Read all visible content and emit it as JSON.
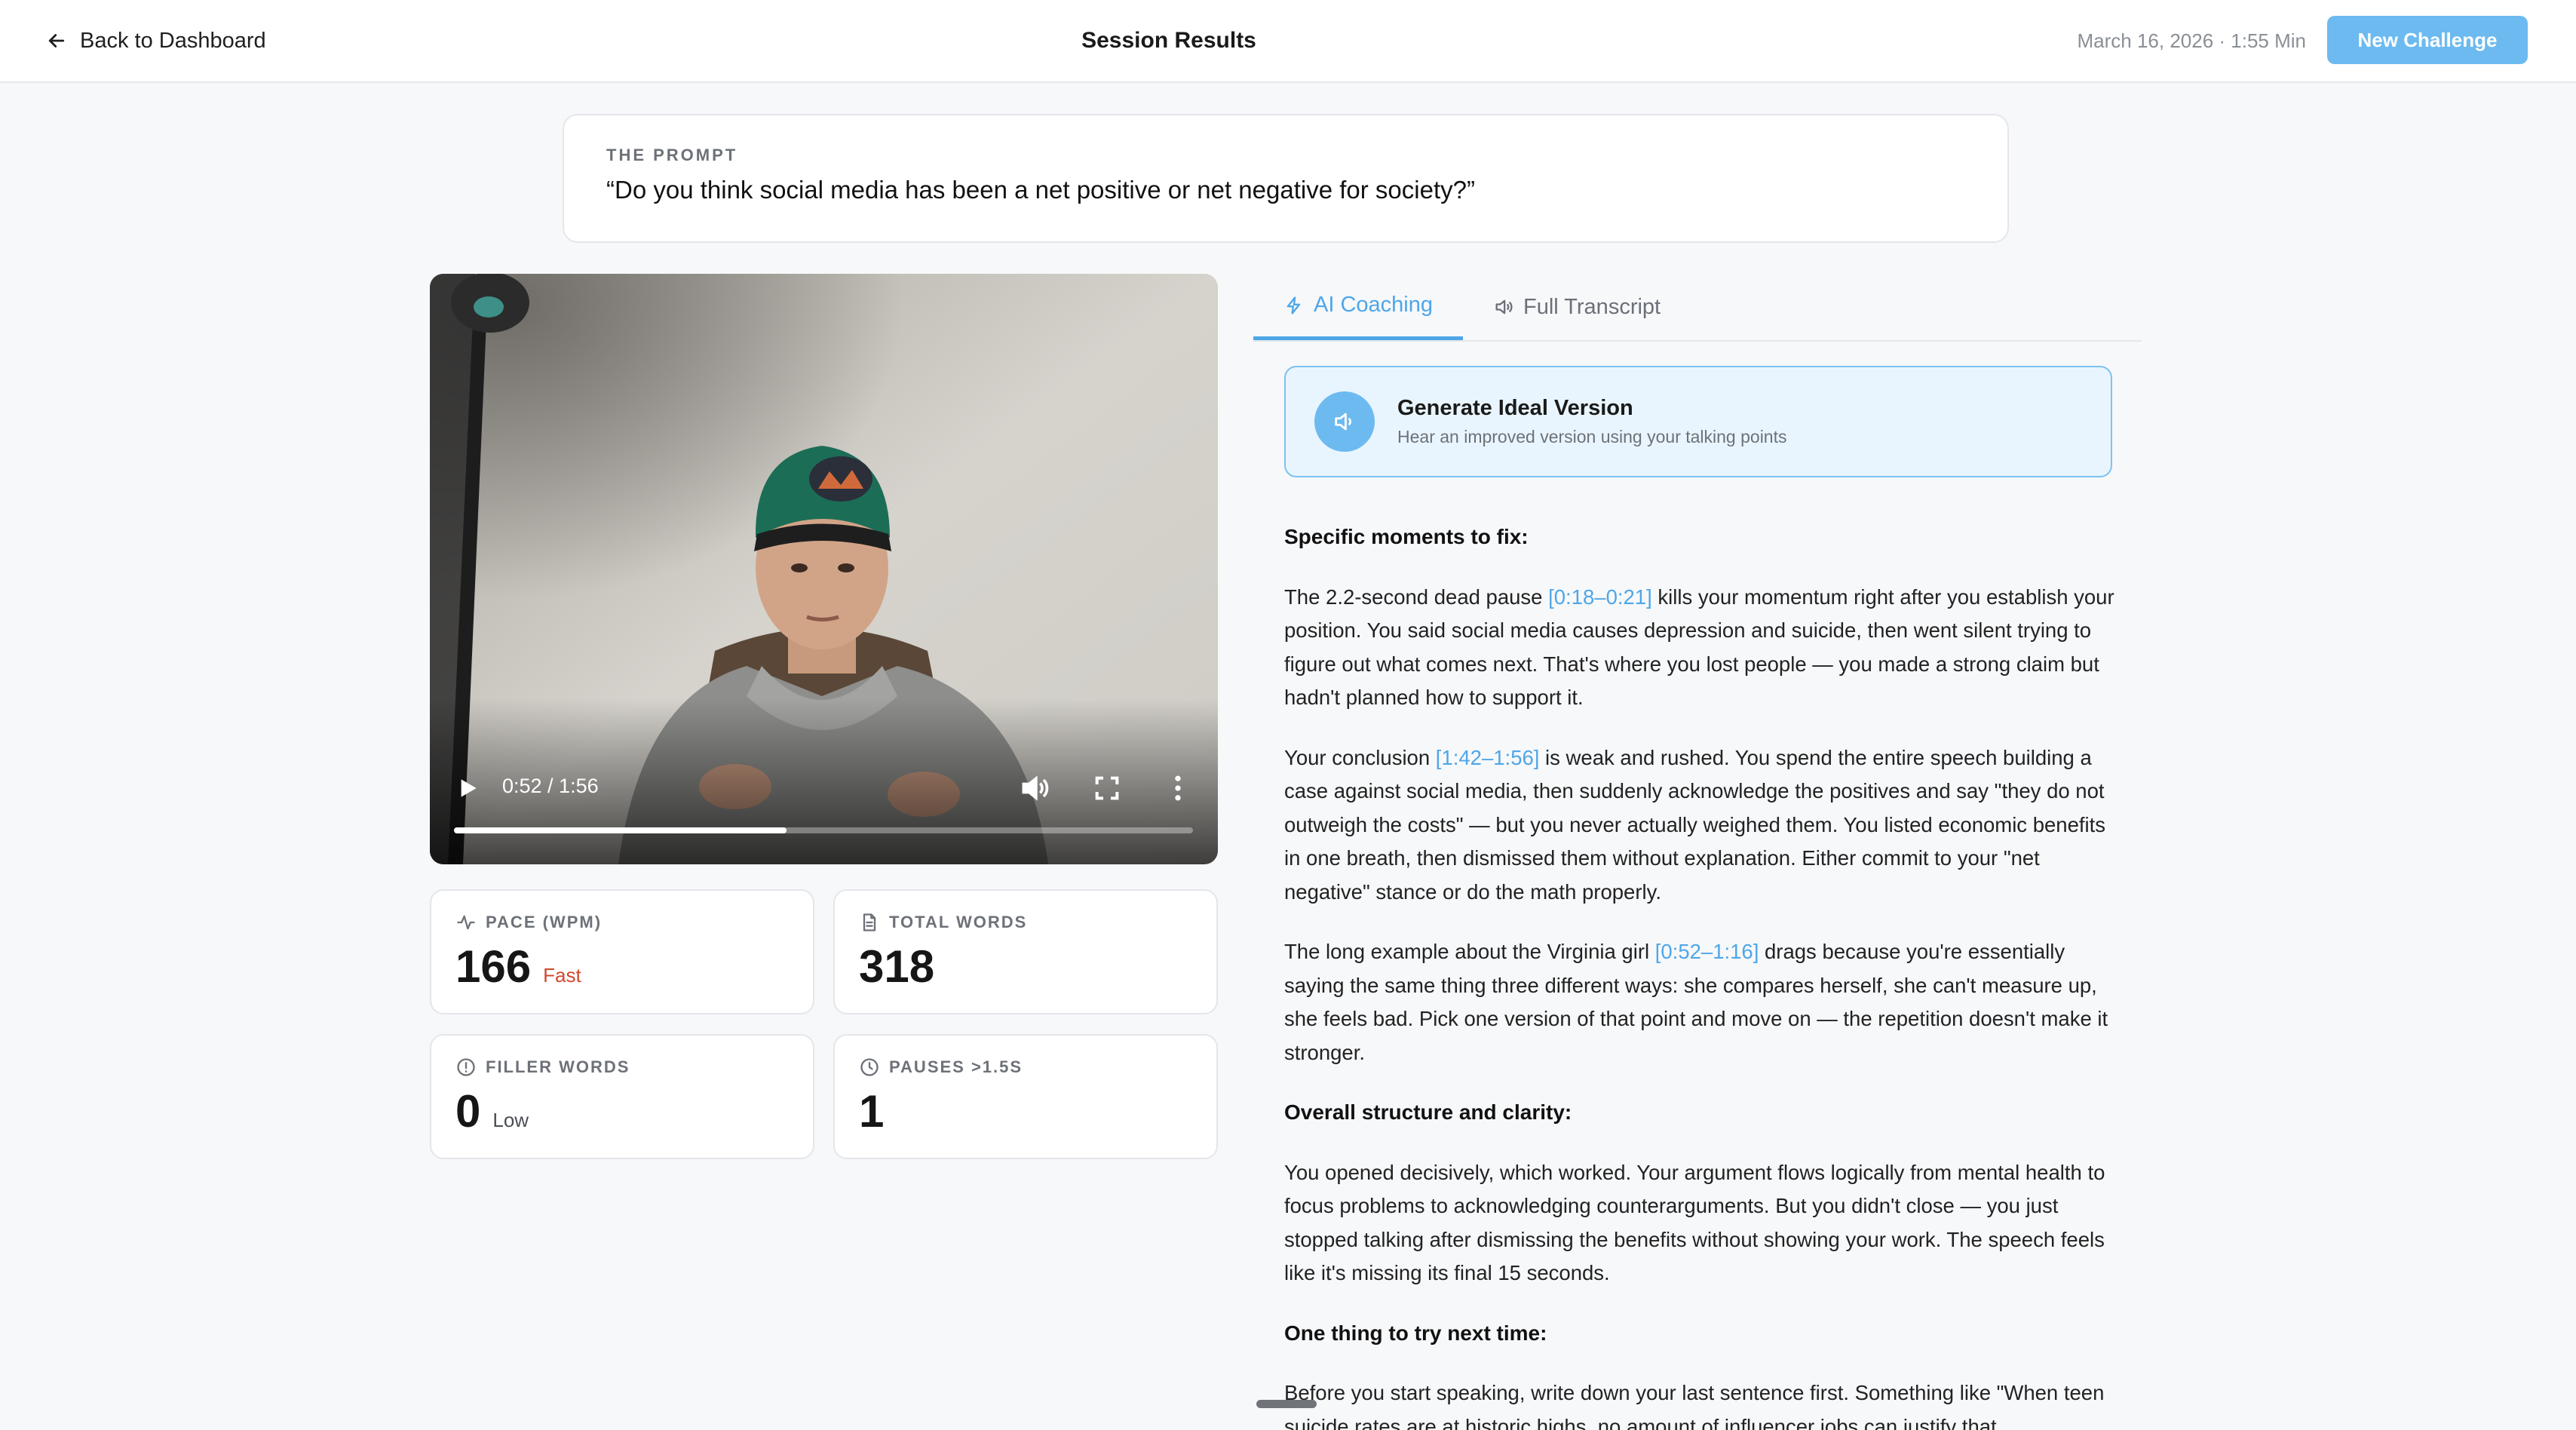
{
  "header": {
    "back_label": "Back to Dashboard",
    "title": "Session Results",
    "meta": "March 16, 2026 · 1:55 Min",
    "new_challenge_label": "New Challenge"
  },
  "prompt": {
    "label": "THE PROMPT",
    "text": "“Do you think social media has been a net positive or net negative for society?”"
  },
  "video": {
    "time": "0:52 / 1:56",
    "progress_fraction": 0.45
  },
  "stats": {
    "pace": {
      "label": "PACE (WPM)",
      "value": "166",
      "tag": "Fast"
    },
    "total_words": {
      "label": "TOTAL WORDS",
      "value": "318"
    },
    "filler_words": {
      "label": "FILLER WORDS",
      "value": "0",
      "tag": "Low"
    },
    "pauses": {
      "label": "PAUSES >1.5S",
      "value": "1"
    }
  },
  "tabs": [
    {
      "label": "AI Coaching",
      "icon": "lightning-icon",
      "active": true
    },
    {
      "label": "Full Transcript",
      "icon": "speaker-icon",
      "active": false
    }
  ],
  "ideal": {
    "title": "Generate Ideal Version",
    "subtitle": "Hear an improved version using your talking points"
  },
  "coaching": {
    "heading_moments": "Specific moments to fix:",
    "p1": {
      "before": "The 2.2-second dead pause ",
      "ts": "[0:18–0:21]",
      "after": " kills your momentum right after you establish your position. You said social media causes depression and suicide, then went silent trying to figure out what comes next. That's where you lost people — you made a strong claim but hadn't planned how to support it."
    },
    "p2": {
      "before": "Your conclusion ",
      "ts": "[1:42–1:56]",
      "after": " is weak and rushed. You spend the entire speech building a case against social media, then suddenly acknowledge the positives and say \"they do not outweigh the costs\" — but you never actually weighed them. You listed economic benefits in one breath, then dismissed them without explanation. Either commit to your \"net negative\" stance or do the math properly."
    },
    "p3": {
      "before": "The long example about the Virginia girl ",
      "ts": "[0:52–1:16]",
      "after": " drags because you're essentially saying the same thing three different ways: she compares herself, she can't measure up, she feels bad. Pick one version of that point and move on — the repetition doesn't make it stronger."
    },
    "heading_structure": "Overall structure and clarity:",
    "p4": "You opened decisively, which worked. Your argument flows logically from mental health to focus problems to acknowledging counterarguments. But you didn't close — you just stopped talking after dismissing the benefits without showing your work. The speech feels like it's missing its final 15 seconds.",
    "heading_next": "One thing to try next time:",
    "p5": "Before you start speaking, write down your last sentence first. Something like \"When teen suicide rates are at historic highs, no amount of influencer jobs can justify that."
  },
  "colors": {
    "accent": "#4ea6e8",
    "button": "#6cbaf0",
    "fast_tag": "#d2482f"
  }
}
